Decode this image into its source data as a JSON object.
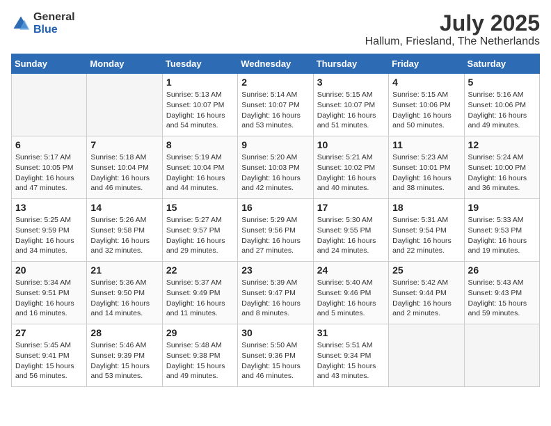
{
  "logo": {
    "general": "General",
    "blue": "Blue"
  },
  "title": "July 2025",
  "location": "Hallum, Friesland, The Netherlands",
  "weekdays": [
    "Sunday",
    "Monday",
    "Tuesday",
    "Wednesday",
    "Thursday",
    "Friday",
    "Saturday"
  ],
  "weeks": [
    [
      {
        "day": "",
        "empty": true
      },
      {
        "day": "",
        "empty": true
      },
      {
        "day": "1",
        "sunrise": "Sunrise: 5:13 AM",
        "sunset": "Sunset: 10:07 PM",
        "daylight": "Daylight: 16 hours and 54 minutes."
      },
      {
        "day": "2",
        "sunrise": "Sunrise: 5:14 AM",
        "sunset": "Sunset: 10:07 PM",
        "daylight": "Daylight: 16 hours and 53 minutes."
      },
      {
        "day": "3",
        "sunrise": "Sunrise: 5:15 AM",
        "sunset": "Sunset: 10:07 PM",
        "daylight": "Daylight: 16 hours and 51 minutes."
      },
      {
        "day": "4",
        "sunrise": "Sunrise: 5:15 AM",
        "sunset": "Sunset: 10:06 PM",
        "daylight": "Daylight: 16 hours and 50 minutes."
      },
      {
        "day": "5",
        "sunrise": "Sunrise: 5:16 AM",
        "sunset": "Sunset: 10:06 PM",
        "daylight": "Daylight: 16 hours and 49 minutes."
      }
    ],
    [
      {
        "day": "6",
        "sunrise": "Sunrise: 5:17 AM",
        "sunset": "Sunset: 10:05 PM",
        "daylight": "Daylight: 16 hours and 47 minutes."
      },
      {
        "day": "7",
        "sunrise": "Sunrise: 5:18 AM",
        "sunset": "Sunset: 10:04 PM",
        "daylight": "Daylight: 16 hours and 46 minutes."
      },
      {
        "day": "8",
        "sunrise": "Sunrise: 5:19 AM",
        "sunset": "Sunset: 10:04 PM",
        "daylight": "Daylight: 16 hours and 44 minutes."
      },
      {
        "day": "9",
        "sunrise": "Sunrise: 5:20 AM",
        "sunset": "Sunset: 10:03 PM",
        "daylight": "Daylight: 16 hours and 42 minutes."
      },
      {
        "day": "10",
        "sunrise": "Sunrise: 5:21 AM",
        "sunset": "Sunset: 10:02 PM",
        "daylight": "Daylight: 16 hours and 40 minutes."
      },
      {
        "day": "11",
        "sunrise": "Sunrise: 5:23 AM",
        "sunset": "Sunset: 10:01 PM",
        "daylight": "Daylight: 16 hours and 38 minutes."
      },
      {
        "day": "12",
        "sunrise": "Sunrise: 5:24 AM",
        "sunset": "Sunset: 10:00 PM",
        "daylight": "Daylight: 16 hours and 36 minutes."
      }
    ],
    [
      {
        "day": "13",
        "sunrise": "Sunrise: 5:25 AM",
        "sunset": "Sunset: 9:59 PM",
        "daylight": "Daylight: 16 hours and 34 minutes."
      },
      {
        "day": "14",
        "sunrise": "Sunrise: 5:26 AM",
        "sunset": "Sunset: 9:58 PM",
        "daylight": "Daylight: 16 hours and 32 minutes."
      },
      {
        "day": "15",
        "sunrise": "Sunrise: 5:27 AM",
        "sunset": "Sunset: 9:57 PM",
        "daylight": "Daylight: 16 hours and 29 minutes."
      },
      {
        "day": "16",
        "sunrise": "Sunrise: 5:29 AM",
        "sunset": "Sunset: 9:56 PM",
        "daylight": "Daylight: 16 hours and 27 minutes."
      },
      {
        "day": "17",
        "sunrise": "Sunrise: 5:30 AM",
        "sunset": "Sunset: 9:55 PM",
        "daylight": "Daylight: 16 hours and 24 minutes."
      },
      {
        "day": "18",
        "sunrise": "Sunrise: 5:31 AM",
        "sunset": "Sunset: 9:54 PM",
        "daylight": "Daylight: 16 hours and 22 minutes."
      },
      {
        "day": "19",
        "sunrise": "Sunrise: 5:33 AM",
        "sunset": "Sunset: 9:53 PM",
        "daylight": "Daylight: 16 hours and 19 minutes."
      }
    ],
    [
      {
        "day": "20",
        "sunrise": "Sunrise: 5:34 AM",
        "sunset": "Sunset: 9:51 PM",
        "daylight": "Daylight: 16 hours and 16 minutes."
      },
      {
        "day": "21",
        "sunrise": "Sunrise: 5:36 AM",
        "sunset": "Sunset: 9:50 PM",
        "daylight": "Daylight: 16 hours and 14 minutes."
      },
      {
        "day": "22",
        "sunrise": "Sunrise: 5:37 AM",
        "sunset": "Sunset: 9:49 PM",
        "daylight": "Daylight: 16 hours and 11 minutes."
      },
      {
        "day": "23",
        "sunrise": "Sunrise: 5:39 AM",
        "sunset": "Sunset: 9:47 PM",
        "daylight": "Daylight: 16 hours and 8 minutes."
      },
      {
        "day": "24",
        "sunrise": "Sunrise: 5:40 AM",
        "sunset": "Sunset: 9:46 PM",
        "daylight": "Daylight: 16 hours and 5 minutes."
      },
      {
        "day": "25",
        "sunrise": "Sunrise: 5:42 AM",
        "sunset": "Sunset: 9:44 PM",
        "daylight": "Daylight: 16 hours and 2 minutes."
      },
      {
        "day": "26",
        "sunrise": "Sunrise: 5:43 AM",
        "sunset": "Sunset: 9:43 PM",
        "daylight": "Daylight: 15 hours and 59 minutes."
      }
    ],
    [
      {
        "day": "27",
        "sunrise": "Sunrise: 5:45 AM",
        "sunset": "Sunset: 9:41 PM",
        "daylight": "Daylight: 15 hours and 56 minutes."
      },
      {
        "day": "28",
        "sunrise": "Sunrise: 5:46 AM",
        "sunset": "Sunset: 9:39 PM",
        "daylight": "Daylight: 15 hours and 53 minutes."
      },
      {
        "day": "29",
        "sunrise": "Sunrise: 5:48 AM",
        "sunset": "Sunset: 9:38 PM",
        "daylight": "Daylight: 15 hours and 49 minutes."
      },
      {
        "day": "30",
        "sunrise": "Sunrise: 5:50 AM",
        "sunset": "Sunset: 9:36 PM",
        "daylight": "Daylight: 15 hours and 46 minutes."
      },
      {
        "day": "31",
        "sunrise": "Sunrise: 5:51 AM",
        "sunset": "Sunset: 9:34 PM",
        "daylight": "Daylight: 15 hours and 43 minutes."
      },
      {
        "day": "",
        "empty": true
      },
      {
        "day": "",
        "empty": true
      }
    ]
  ]
}
